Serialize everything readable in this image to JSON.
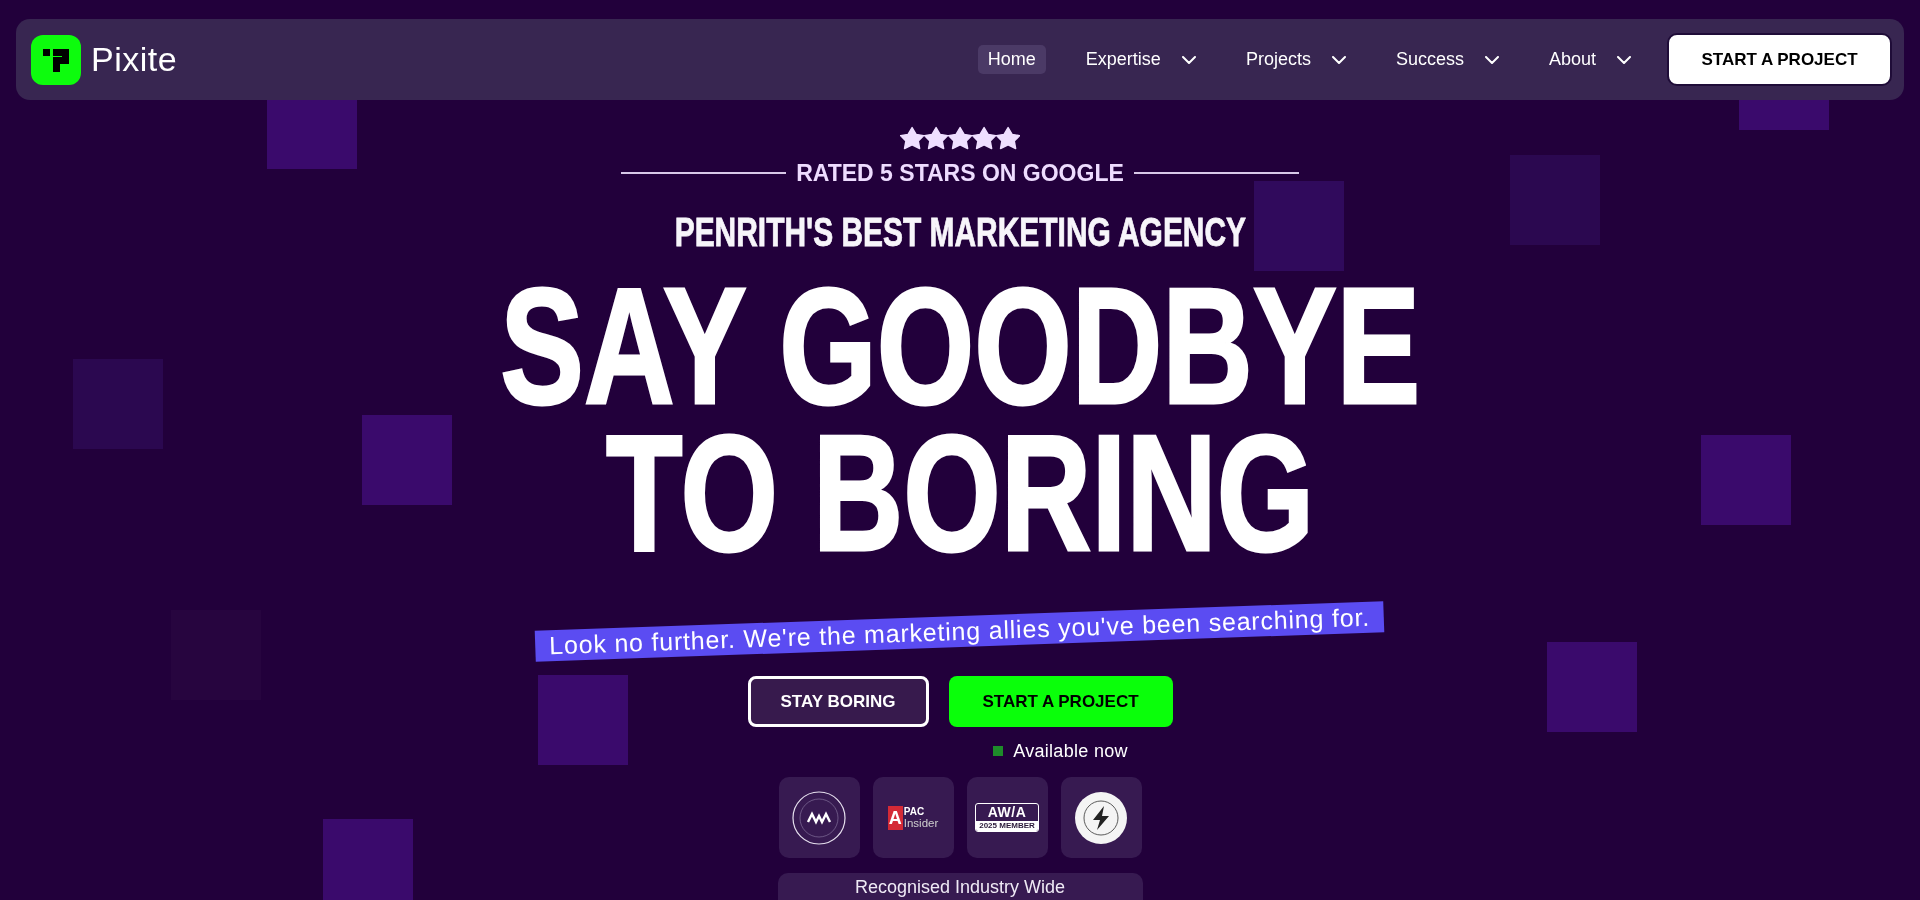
{
  "nav": {
    "brand": "Pixite",
    "items": [
      {
        "label": "Home",
        "selected": true,
        "has_menu": false
      },
      {
        "label": "Expertise",
        "selected": false,
        "has_menu": true
      },
      {
        "label": "Projects",
        "selected": false,
        "has_menu": true
      },
      {
        "label": "Success",
        "selected": false,
        "has_menu": true
      },
      {
        "label": "About",
        "selected": false,
        "has_menu": true
      }
    ],
    "cta": "START A PROJECT"
  },
  "hero": {
    "rating": {
      "stars": 5,
      "label": "RATED 5 STARS ON GOOGLE"
    },
    "eyebrow": "PENRITH'S BEST MARKETING AGENCY",
    "headline_lines": [
      "SAY GOODBYE",
      "TO BORING"
    ],
    "tagline": "Look no further. We're the marketing allies you've been searching for.",
    "buttons": [
      {
        "label": "STAY BORING",
        "kind": "outline"
      },
      {
        "label": "START A PROJECT",
        "kind": "primary"
      }
    ],
    "availability": {
      "label": "Available now",
      "available": true
    }
  },
  "awards": {
    "badges": [
      {
        "kind": "ring_seal"
      },
      {
        "kind": "red_mark",
        "mark": "A",
        "title": "PAC",
        "subtitle": "Insider"
      },
      {
        "kind": "plate",
        "title": "AW/A",
        "subtitle": "2025 MEMBER"
      },
      {
        "kind": "white_seal"
      }
    ],
    "caption": "Recognised Industry Wide"
  }
}
